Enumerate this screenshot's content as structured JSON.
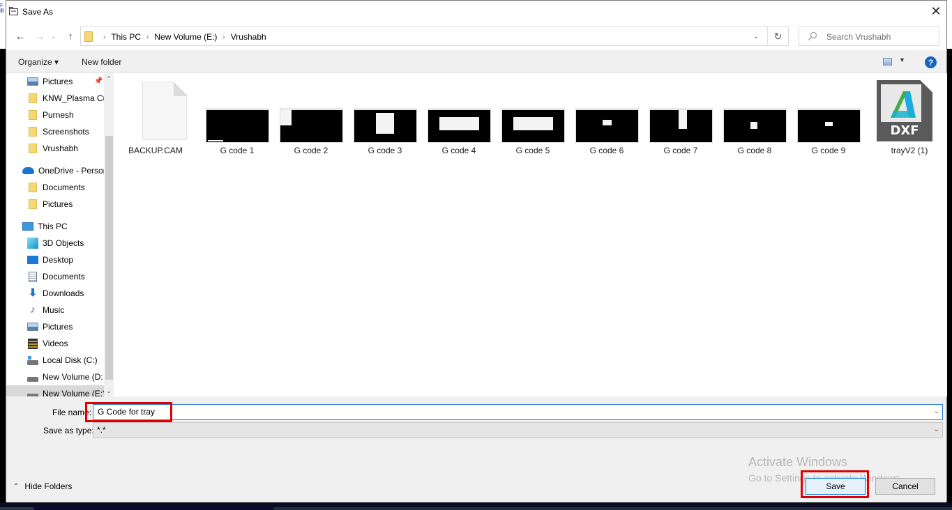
{
  "window": {
    "title": "Save As",
    "close_label": "✕"
  },
  "navigation": {
    "back_label": "←",
    "forward_label": "→",
    "recent_label": "⌄",
    "up_label": "↑",
    "breadcrumb": [
      "This PC",
      "New Volume (E:)",
      "Vrushabh"
    ],
    "separator": "›",
    "dropdown_label": "⌄",
    "refresh_label": "↻",
    "search_placeholder": "Search Vrushabh"
  },
  "toolbar": {
    "organize_label": "Organize ▾",
    "new_folder_label": "New folder",
    "view_dd_label": "▼",
    "help_label": "?"
  },
  "sidebar": {
    "items": [
      {
        "label": "Pictures",
        "icon": "pictures-icon",
        "pinned": true
      },
      {
        "label": "KNW_Plasma Cu",
        "icon": "folder-icon"
      },
      {
        "label": "Purnesh",
        "icon": "folder-icon"
      },
      {
        "label": "Screenshots",
        "icon": "folder-icon"
      },
      {
        "label": "Vrushabh",
        "icon": "folder-icon"
      },
      {
        "label": "OneDrive - Persor",
        "icon": "onedrive-icon"
      },
      {
        "label": "Documents",
        "icon": "folder-icon"
      },
      {
        "label": "Pictures",
        "icon": "folder-icon"
      },
      {
        "label": "This PC",
        "icon": "this-pc-icon"
      },
      {
        "label": "3D Objects",
        "icon": "3d-objects-icon"
      },
      {
        "label": "Desktop",
        "icon": "desktop-icon"
      },
      {
        "label": "Documents",
        "icon": "documents-icon"
      },
      {
        "label": "Downloads",
        "icon": "downloads-icon"
      },
      {
        "label": "Music",
        "icon": "music-icon"
      },
      {
        "label": "Pictures",
        "icon": "pictures-icon"
      },
      {
        "label": "Videos",
        "icon": "videos-icon"
      },
      {
        "label": "Local Disk (C:)",
        "icon": "local-disk-icon"
      },
      {
        "label": "New Volume (D:",
        "icon": "drive-icon"
      },
      {
        "label": "New Volume (E:)",
        "icon": "drive-icon",
        "selected": true
      }
    ],
    "scroll_up": "⌃",
    "scroll_down": "⌄"
  },
  "files": [
    {
      "name": "BACKUP.CAM",
      "type": "generic-file"
    },
    {
      "name": "G code 1",
      "type": "image"
    },
    {
      "name": "G code 2",
      "type": "image"
    },
    {
      "name": "G code 3",
      "type": "image"
    },
    {
      "name": "G code 4",
      "type": "image"
    },
    {
      "name": "G code 5",
      "type": "image"
    },
    {
      "name": "G code 6",
      "type": "image"
    },
    {
      "name": "G code 7",
      "type": "image"
    },
    {
      "name": "G code 8",
      "type": "image"
    },
    {
      "name": "G code 9",
      "type": "image"
    },
    {
      "name": "trayV2 (1)",
      "type": "dxf",
      "badge": "DXF"
    }
  ],
  "form": {
    "file_name_label": "File name:",
    "file_name_value": "G Code for tray",
    "save_as_type_label": "Save as type:",
    "save_as_type_value": "*.*",
    "dropdown_arrow": "⌄"
  },
  "footer": {
    "hide_folders_label": "Hide Folders",
    "hide_folders_chevron": "⌃",
    "save_label": "Save",
    "cancel_label": "Cancel"
  },
  "watermark": {
    "line1": "Activate Windows",
    "line2": "Go to Settings to activate Windows."
  },
  "colors": {
    "highlight": "#e00000",
    "accent": "#0078d7",
    "help": "#1565c0"
  }
}
